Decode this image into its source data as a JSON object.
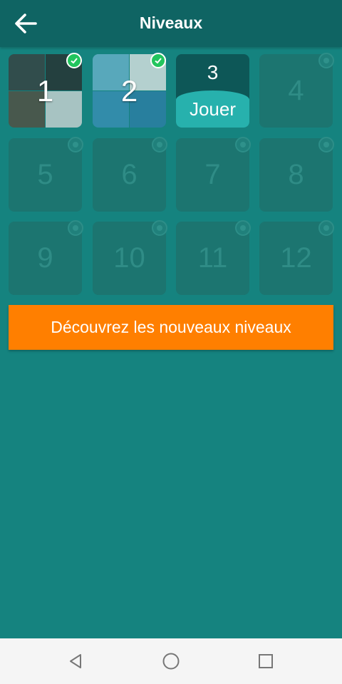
{
  "header": {
    "title": "Niveaux"
  },
  "levels": [
    {
      "number": "1",
      "status": "completed"
    },
    {
      "number": "2",
      "status": "completed"
    },
    {
      "number": "3",
      "status": "current",
      "action_label": "Jouer"
    },
    {
      "number": "4",
      "status": "locked"
    },
    {
      "number": "5",
      "status": "locked"
    },
    {
      "number": "6",
      "status": "locked"
    },
    {
      "number": "7",
      "status": "locked"
    },
    {
      "number": "8",
      "status": "locked"
    },
    {
      "number": "9",
      "status": "locked"
    },
    {
      "number": "10",
      "status": "locked"
    },
    {
      "number": "11",
      "status": "locked"
    },
    {
      "number": "12",
      "status": "locked"
    }
  ],
  "cta": {
    "label": "Découvrez les nouveaux niveaux"
  },
  "colors": {
    "background": "#15837f",
    "header": "#0f6463",
    "cta": "#ff7f00",
    "check": "#22c55e"
  },
  "icons": {
    "back": "back-arrow-icon",
    "check": "checkmark-icon",
    "lock": "lock-icon",
    "nav_back": "triangle-back-icon",
    "nav_home": "circle-home-icon",
    "nav_recent": "square-recent-icon"
  }
}
